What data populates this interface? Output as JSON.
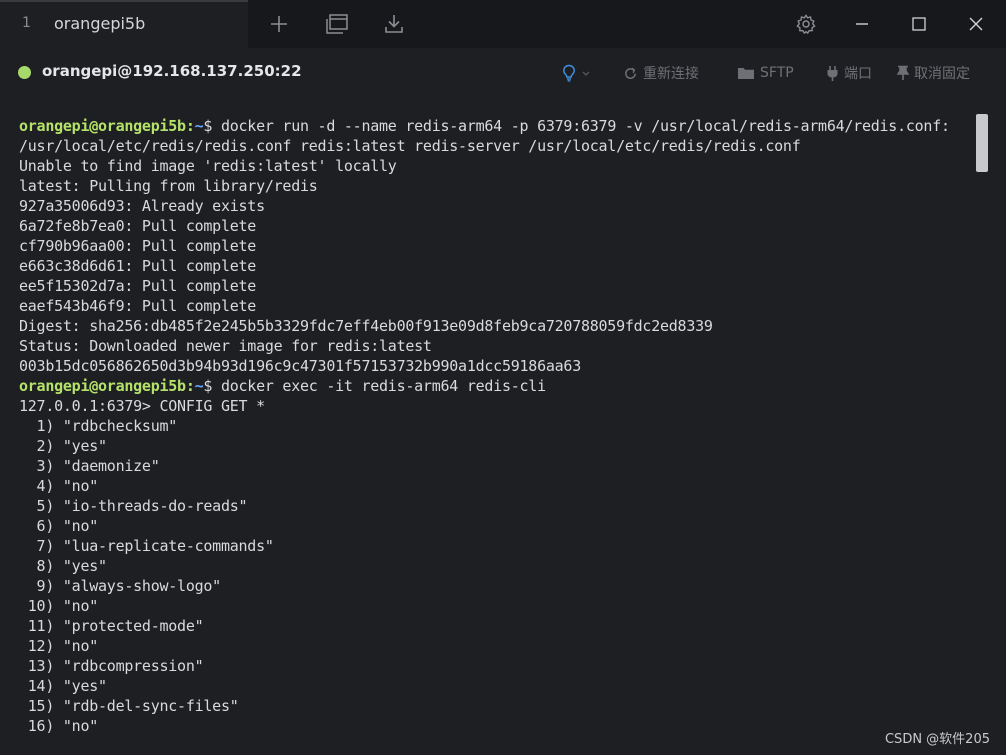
{
  "tab": {
    "index": "1",
    "title": "orangepi5b"
  },
  "connection": {
    "host": "orangepi@192.168.137.250:22",
    "reconnect_label": "重新连接",
    "sftp_label": "SFTP",
    "port_label": "端口",
    "unpin_label": "取消固定"
  },
  "colors": {
    "status_dot": "#a6d96a",
    "prompt_user": "#b5e36a",
    "prompt_path": "#6aa6ff",
    "terminal_bg": "#1e1f22",
    "terminal_fg": "#d8dadd"
  },
  "terminal": {
    "prompt": {
      "user": "orangepi@orangepi5b",
      "sep": ":",
      "path": "~",
      "symbol": "$ "
    },
    "lines": [
      {
        "kind": "prompt",
        "text": "docker run -d --name redis-arm64 -p 6379:6379 -v /usr/local/redis-arm64/redis.conf:"
      },
      {
        "kind": "out",
        "text": "/usr/local/etc/redis/redis.conf redis:latest redis-server /usr/local/etc/redis/redis.conf"
      },
      {
        "kind": "out",
        "text": "Unable to find image 'redis:latest' locally"
      },
      {
        "kind": "out",
        "text": "latest: Pulling from library/redis"
      },
      {
        "kind": "out",
        "text": "927a35006d93: Already exists"
      },
      {
        "kind": "out",
        "text": "6a72fe8b7ea0: Pull complete"
      },
      {
        "kind": "out",
        "text": "cf790b96aa00: Pull complete"
      },
      {
        "kind": "out",
        "text": "e663c38d6d61: Pull complete"
      },
      {
        "kind": "out",
        "text": "ee5f15302d7a: Pull complete"
      },
      {
        "kind": "out",
        "text": "eaef543b46f9: Pull complete"
      },
      {
        "kind": "out",
        "text": "Digest: sha256:db485f2e245b5b3329fdc7eff4eb00f913e09d8feb9ca720788059fdc2ed8339"
      },
      {
        "kind": "out",
        "text": "Status: Downloaded newer image for redis:latest"
      },
      {
        "kind": "out",
        "text": "003b15dc056862650d3b94b93d196c9c47301f57153732b990a1dcc59186aa63"
      },
      {
        "kind": "prompt",
        "text": "docker exec -it redis-arm64 redis-cli"
      },
      {
        "kind": "out",
        "text": "127.0.0.1:6379> CONFIG GET *"
      },
      {
        "kind": "out",
        "text": "  1) \"rdbchecksum\""
      },
      {
        "kind": "out",
        "text": "  2) \"yes\""
      },
      {
        "kind": "out",
        "text": "  3) \"daemonize\""
      },
      {
        "kind": "out",
        "text": "  4) \"no\""
      },
      {
        "kind": "out",
        "text": "  5) \"io-threads-do-reads\""
      },
      {
        "kind": "out",
        "text": "  6) \"no\""
      },
      {
        "kind": "out",
        "text": "  7) \"lua-replicate-commands\""
      },
      {
        "kind": "out",
        "text": "  8) \"yes\""
      },
      {
        "kind": "out",
        "text": "  9) \"always-show-logo\""
      },
      {
        "kind": "out",
        "text": " 10) \"no\""
      },
      {
        "kind": "out",
        "text": " 11) \"protected-mode\""
      },
      {
        "kind": "out",
        "text": " 12) \"no\""
      },
      {
        "kind": "out",
        "text": " 13) \"rdbcompression\""
      },
      {
        "kind": "out",
        "text": " 14) \"yes\""
      },
      {
        "kind": "out",
        "text": " 15) \"rdb-del-sync-files\""
      },
      {
        "kind": "out",
        "text": " 16) \"no\""
      }
    ]
  },
  "watermark": "CSDN @软件205"
}
